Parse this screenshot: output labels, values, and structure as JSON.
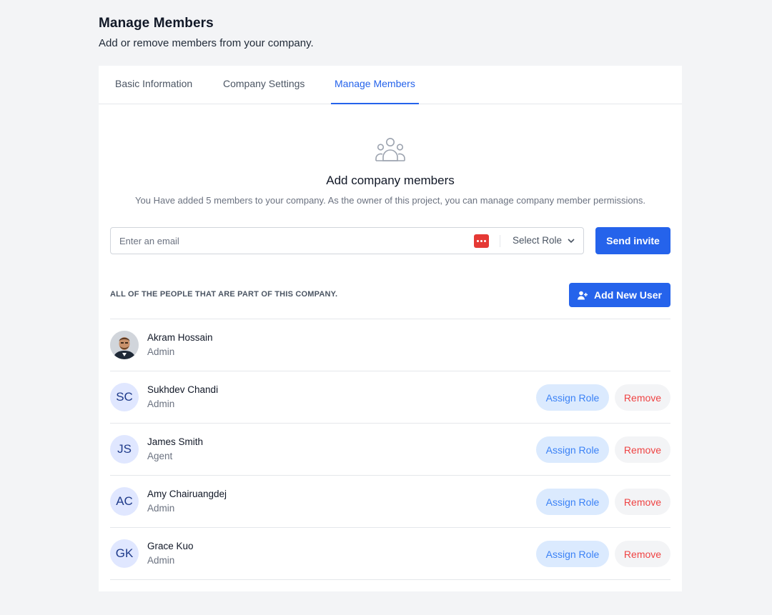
{
  "header": {
    "title": "Manage Members",
    "subtitle": "Add or remove members from your company."
  },
  "tabs": [
    {
      "label": "Basic Information",
      "active": false
    },
    {
      "label": "Company Settings",
      "active": false
    },
    {
      "label": "Manage Members",
      "active": true
    }
  ],
  "hero": {
    "icon": "users-group-icon",
    "title": "Add company members",
    "description": "You Have added 5 members to your company. As the owner of this project, you can manage company member permissions."
  },
  "invite": {
    "email_placeholder": "Enter an email",
    "email_value": "",
    "role_select_label": "Select Role",
    "send_label": "Send invite"
  },
  "people": {
    "section_label": "ALL OF THE PEOPLE THAT ARE PART OF THIS COMPANY.",
    "add_user_label": "Add New User",
    "assign_label": "Assign Role",
    "remove_label": "Remove",
    "members": [
      {
        "name": "Akram Hossain",
        "role": "Admin",
        "initials": "",
        "has_photo": true
      },
      {
        "name": "Sukhdev Chandi",
        "role": "Admin",
        "initials": "SC",
        "has_photo": false
      },
      {
        "name": "James Smith",
        "role": "Agent",
        "initials": "JS",
        "has_photo": false
      },
      {
        "name": "Amy Chairuangdej",
        "role": "Admin",
        "initials": "AC",
        "has_photo": false
      },
      {
        "name": "Grace Kuo",
        "role": "Admin",
        "initials": "GK",
        "has_photo": false
      }
    ]
  },
  "colors": {
    "accent": "#2563eb",
    "danger": "#ef4444",
    "assign_bg": "#dbeafe",
    "remove_bg": "#f3f4f6",
    "page_bg": "#f3f4f6"
  }
}
